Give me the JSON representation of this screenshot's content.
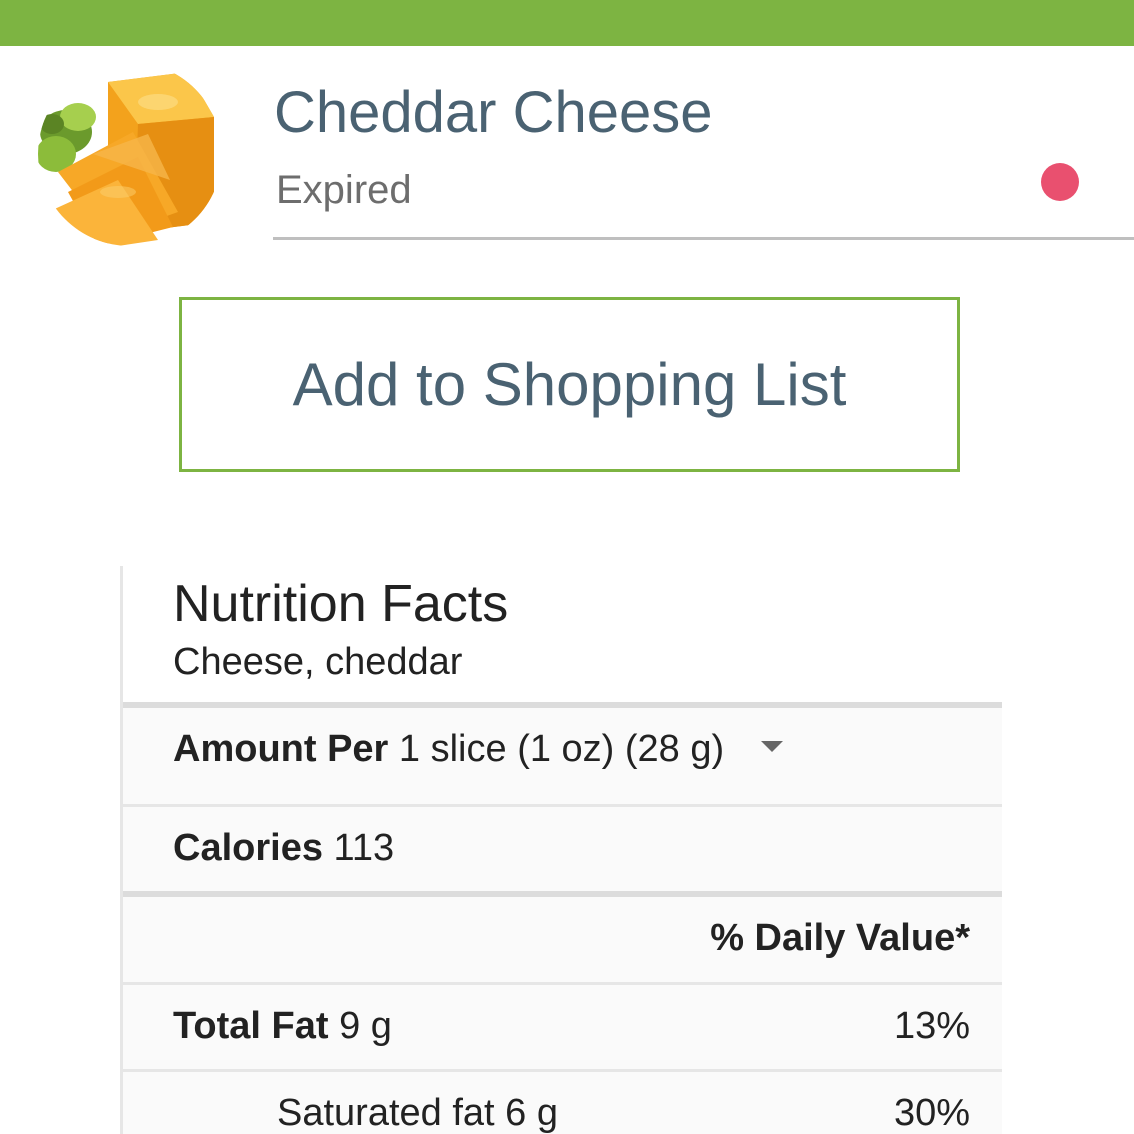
{
  "header": {
    "bar_color": "#7db442"
  },
  "product": {
    "name": "Cheddar Cheese",
    "status": "Expired",
    "status_color": "#e9506f",
    "image_icon": "cheddar-cheese-image"
  },
  "actions": {
    "add_to_list_label": "Add to Shopping List"
  },
  "nutrition": {
    "title": "Nutrition Facts",
    "subtitle": "Cheese, cheddar",
    "amount_per_label": "Amount Per",
    "serving": "1 slice (1 oz) (28 g)",
    "serving_dropdown_icon": "caret-down-icon",
    "calories_label": "Calories",
    "calories_value": "113",
    "daily_value_header": "% Daily Value*",
    "rows": [
      {
        "label": "Total Fat",
        "amount": "9 g",
        "percent": "13%"
      },
      {
        "label": "Saturated fat",
        "amount": "6 g",
        "percent": "30%"
      }
    ]
  }
}
